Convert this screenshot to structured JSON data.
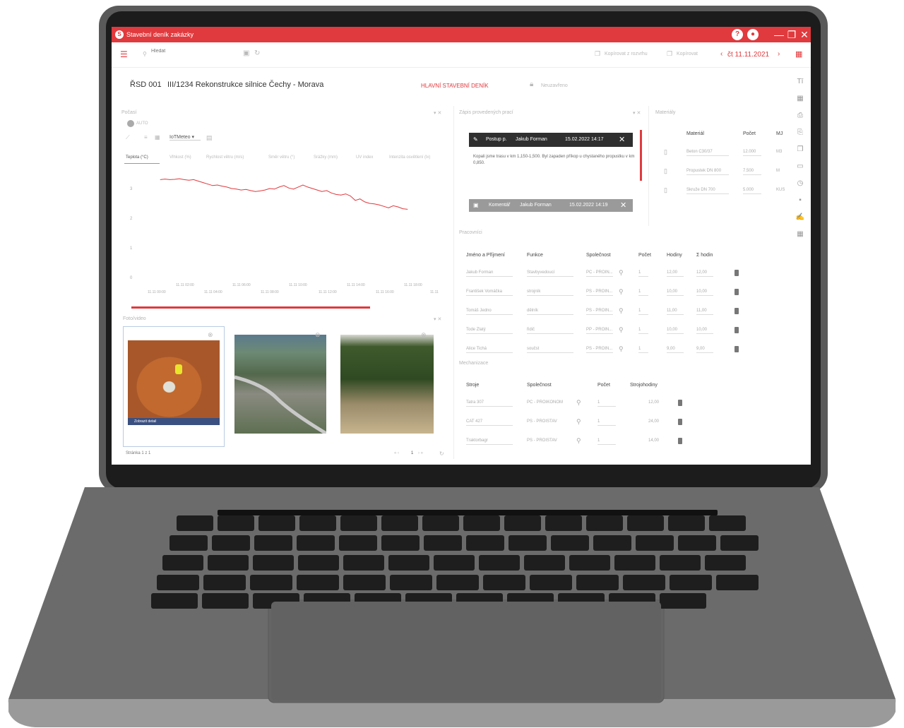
{
  "window": {
    "title": "Stavební deník zakázky",
    "help_icon": "?",
    "close": "✕",
    "maximize": "❐",
    "minimize": "—"
  },
  "toolbar": {
    "search_placeholder": "Hledat",
    "copy_from_template": "Kopírovat z rozvrhu",
    "copy": "Kopírovat",
    "date": "čt 11.11.2021"
  },
  "header": {
    "project_code": "ŘSD 001",
    "project_name": "III/1234 Rekonstrukce silnice Čechy - Morava",
    "diary_type": "HLAVNÍ STAVEBNÍ DENÍK",
    "lock_status": "Neuzavřeno"
  },
  "weather": {
    "panel_title": "Počasí",
    "auto_label": "AUTO",
    "source": "IoTMeteo",
    "tabs": [
      "Teplota (°C)",
      "Vlhkost (%)",
      "Rychlost větru (m/s)",
      "Směr větru (°)",
      "Srážky (mm)",
      "UV index",
      "Intenzita osvětlení (lx)"
    ],
    "y_ticks": [
      "3",
      "2",
      "1",
      "0"
    ],
    "x_ticks_top": [
      "11.11 02:00",
      "11.11 06:00",
      "11.11 10:00",
      "11.11 14:00",
      "11.11 18:00"
    ],
    "x_ticks_bottom": [
      "11.11 00:00",
      "11.11 04:00",
      "11.11 08:00",
      "11.11 12:00",
      "11.11 16:00",
      "11.11"
    ]
  },
  "chart_data": {
    "type": "line",
    "title": "",
    "xlabel": "",
    "ylabel": "",
    "y_ticks": [
      0,
      1,
      2,
      3
    ],
    "ylim": [
      0,
      3.5
    ],
    "series": [
      {
        "values": [
          3.3,
          3.32,
          3.3,
          3.31,
          3.33,
          3.3,
          3.28,
          3.3,
          3.25,
          3.2,
          3.15,
          3.1,
          3.12,
          3.08,
          3.05,
          3.0,
          2.98,
          2.95,
          2.97,
          2.93,
          2.9,
          2.92,
          2.95,
          3.0,
          2.98,
          3.05,
          3.1,
          3.02,
          2.98,
          3.05,
          3.12,
          3.05,
          3.0,
          2.95,
          2.9,
          2.93,
          2.85,
          2.8,
          2.78,
          2.82,
          2.75,
          2.6,
          2.65,
          2.55,
          2.5,
          2.48,
          2.45,
          2.4,
          2.35,
          2.42,
          2.38,
          2.32,
          2.3
        ]
      }
    ],
    "color": "#e03a3e"
  },
  "photos": {
    "panel_title": "Foto/video",
    "caption": "Zobrazit detail",
    "pager": "Stránka 1 z 1",
    "page": "1"
  },
  "notes": {
    "panel_title": "Zápis provedených prací",
    "entry1": {
      "type": "Postup p.",
      "author": "Jakub Forman",
      "date": "15.02.2022 14:17",
      "text": "Kopali jsme trasu v km 1,150-1,500. Byl zapaden příkop u chystaného propustku v km 0,850."
    },
    "entry2": {
      "type": "Komentář",
      "author": "Jakub Forman",
      "date": "15.02.2022 14:19"
    }
  },
  "materials": {
    "panel_title": "Materiály",
    "headers": [
      "Materiál",
      "Počet",
      "MJ"
    ],
    "rows": [
      [
        "Beton C30/37",
        "12.000",
        "M3"
      ],
      [
        "Propustek DN 800",
        "7.500",
        "M"
      ],
      [
        "Skruže DN 700",
        "5.000",
        "KUS"
      ]
    ]
  },
  "workers": {
    "panel_title": "Pracovníci",
    "headers": [
      "Jméno a Příjmení",
      "Funkce",
      "Společnost",
      "Počet",
      "Hodiny",
      "Σ hodin"
    ],
    "rows": [
      [
        "Jakub Forman",
        "Stavbyvedoucí",
        "PC - PROIN...",
        "1",
        "12,00",
        "12,00"
      ],
      [
        "František Vomáčka",
        "strojník",
        "PS - PROIN...",
        "1",
        "10,00",
        "10,00"
      ],
      [
        "Tomáš Jedno",
        "dělník",
        "PS - PROIN...",
        "1",
        "11,00",
        "11,00"
      ],
      [
        "Tode Zlatý",
        "řidič",
        "PP - PROIN...",
        "1",
        "10,00",
        "10,00"
      ],
      [
        "Alice Tichá",
        "součst",
        "PS - PROIN...",
        "1",
        "9,00",
        "9,00"
      ]
    ]
  },
  "machines": {
    "panel_title": "Mechanizace",
    "headers": [
      "Stroje",
      "Společnost",
      "Počet",
      "Strojohodiny"
    ],
    "rows": [
      [
        "Tatra 307",
        "PC - PROIKONOM",
        "1",
        "12,00"
      ],
      [
        "CAT 427",
        "PS - PROISTAV",
        "1",
        "24,00"
      ],
      [
        "Traktorbagr",
        "PS - PROISTAV",
        "1",
        "14,00"
      ]
    ]
  }
}
